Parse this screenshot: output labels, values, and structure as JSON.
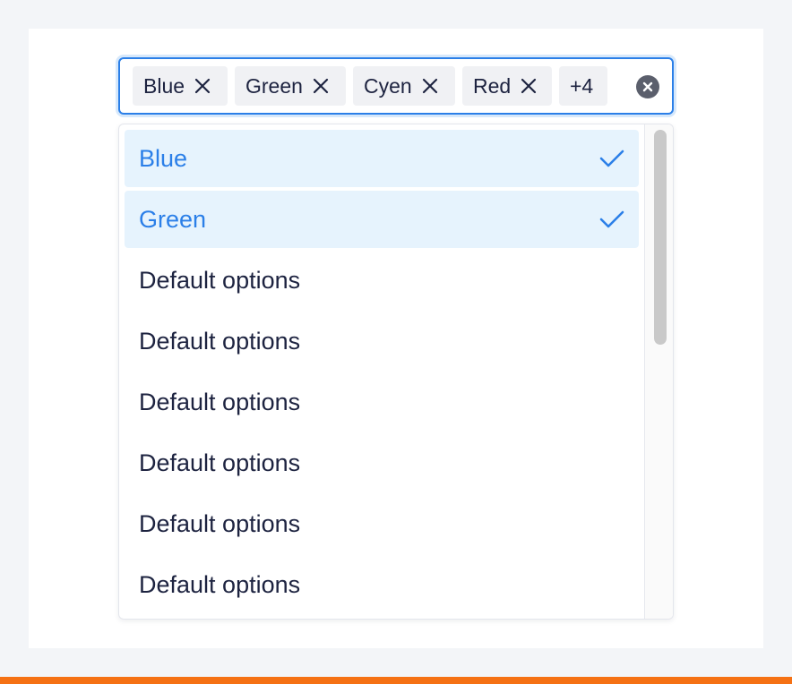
{
  "select": {
    "tags": [
      {
        "label": "Blue"
      },
      {
        "label": "Green"
      },
      {
        "label": "Cyen"
      },
      {
        "label": "Red"
      }
    ],
    "more_count": "+4",
    "icons": {
      "tag_close": "close-icon",
      "clear": "clear-circle-icon"
    }
  },
  "dropdown": {
    "options": [
      {
        "label": "Blue",
        "selected": true
      },
      {
        "label": "Green",
        "selected": true
      },
      {
        "label": "Default options",
        "selected": false
      },
      {
        "label": "Default options",
        "selected": false
      },
      {
        "label": "Default options",
        "selected": false
      },
      {
        "label": "Default options",
        "selected": false
      },
      {
        "label": "Default options",
        "selected": false
      },
      {
        "label": "Default options",
        "selected": false
      }
    ],
    "selected_icon": "check-icon"
  },
  "colors": {
    "accent": "#2b7fe8",
    "selected_background": "#e6f3fd",
    "tag_background": "#f0f1f4",
    "text": "#1d2340",
    "bottom_bar": "#f57114"
  }
}
